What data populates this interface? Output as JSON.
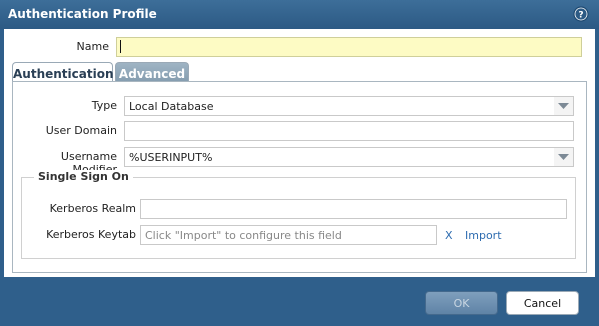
{
  "window": {
    "title": "Authentication Profile"
  },
  "form": {
    "name_label": "Name",
    "name_value": ""
  },
  "tabs": [
    {
      "label": "Authentication",
      "active": true
    },
    {
      "label": "Advanced",
      "active": false
    }
  ],
  "authentication": {
    "type_label": "Type",
    "type_value": "Local Database",
    "user_domain_label": "User Domain",
    "user_domain_value": "",
    "username_modifier_label": "Username Modifier",
    "username_modifier_value": "%USERINPUT%",
    "sso": {
      "title": "Single Sign On",
      "kerberos_realm_label": "Kerberos Realm",
      "kerberos_realm_value": "",
      "kerberos_keytab_label": "Kerberos Keytab",
      "kerberos_keytab_placeholder": "Click \"Import\" to configure this field",
      "clear_label": "X",
      "import_label": "Import"
    }
  },
  "buttons": {
    "ok": "OK",
    "cancel": "Cancel"
  },
  "icons": {
    "help": "help-icon",
    "dropdown": "chevron-down-icon"
  },
  "colors": {
    "titlebar": "#2f5f8b",
    "name_field_bg": "#fdfbc4",
    "link": "#2e6cb0"
  }
}
